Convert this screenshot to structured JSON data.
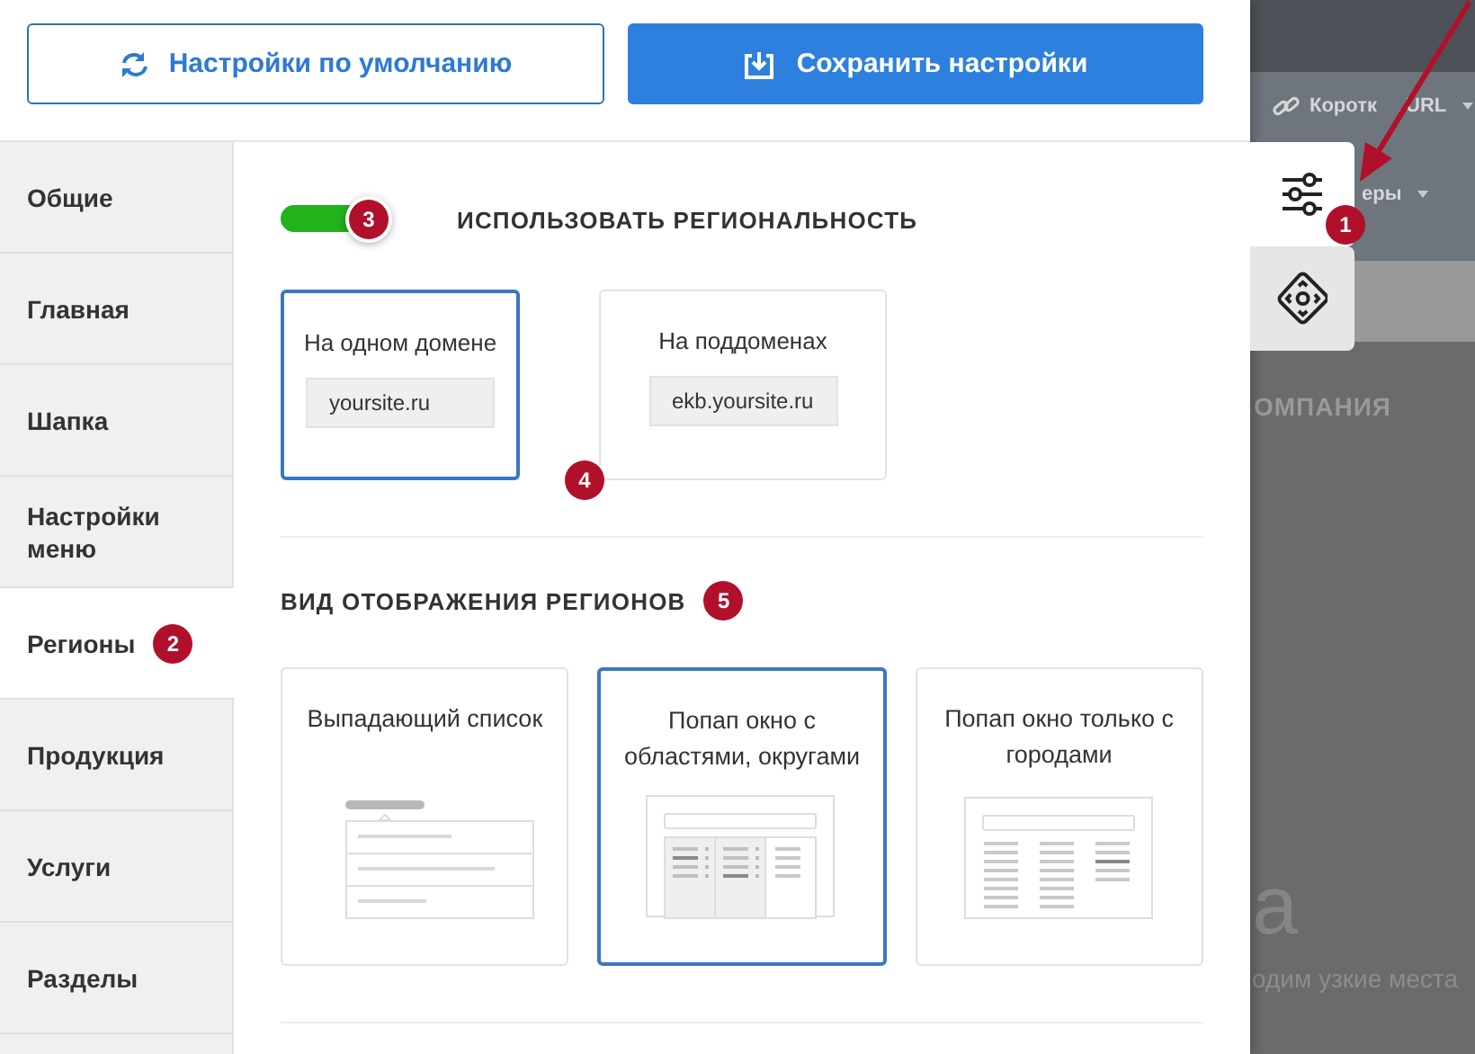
{
  "toolbar": {
    "buttons": [
      {
        "label": "Настройки по умолчанию",
        "kind": "outline"
      },
      {
        "label": "Сохранить настройки",
        "kind": "primary"
      }
    ]
  },
  "sidebar": {
    "items": [
      {
        "label": "Общие",
        "selected": false
      },
      {
        "label": "Главная",
        "selected": false
      },
      {
        "label": "Шапка",
        "selected": false
      },
      {
        "label": "Настройки меню",
        "selected": false
      },
      {
        "label": "Регионы",
        "selected": true,
        "badge": "2"
      },
      {
        "label": "Продукция",
        "selected": false
      },
      {
        "label": "Услуги",
        "selected": false
      },
      {
        "label": "Разделы",
        "selected": false
      }
    ]
  },
  "regionality": {
    "toggle": {
      "on": true,
      "badge": "3"
    },
    "title": "ИСПОЛЬЗОВАТЬ РЕГИОНАЛЬНОСТЬ",
    "badge": "4",
    "options": [
      {
        "label": "На одном домене",
        "example": "yoursite.ru",
        "selected": true
      },
      {
        "label": "На поддоменах",
        "example": "ekb.yoursite.ru",
        "selected": false
      }
    ]
  },
  "display": {
    "title": "ВИД ОТОБРАЖЕНИЯ РЕГИОНОВ",
    "badge": "5",
    "options": [
      {
        "label": "Выпадающий список",
        "kind": "dropdown",
        "selected": false
      },
      {
        "label": "Попап окно с областями, округами",
        "kind": "regions",
        "selected": true
      },
      {
        "label": "Попап окно только с городами",
        "kind": "cities",
        "selected": false
      }
    ]
  },
  "side_tabs": [
    {
      "kind": "settings",
      "selected": true,
      "badge": "1"
    },
    {
      "kind": "navigation",
      "selected": false
    }
  ],
  "backdrop": {
    "menu": [
      {
        "label": "Коротк",
        "kind": "link"
      },
      {
        "label": "URL",
        "kind": "dropdown"
      },
      {
        "label": "еры",
        "kind": "dropdown"
      }
    ],
    "heading": "ОМПАНИЯ",
    "big_letter": "а",
    "text": "одим узкие места"
  }
}
